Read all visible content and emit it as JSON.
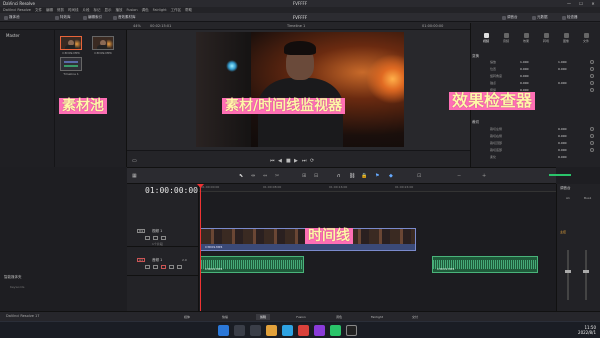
{
  "window": {
    "app_name": "DaVinci Resolve",
    "project_title": "FVFFFF",
    "controls": [
      "—",
      "☐",
      "✕"
    ]
  },
  "menu": [
    "DaVinci Resolve",
    "文件",
    "编辑",
    "修剪",
    "时间线",
    "片段",
    "标记",
    "显示",
    "播放",
    "Fusion",
    "调色",
    "Fairlight",
    "工作区",
    "帮助"
  ],
  "toolbar": {
    "media_pool": "媒体池",
    "effects": "特效库",
    "edit_index": "编辑索引",
    "sound_library": "音效素材库",
    "mixer": "调音台",
    "metadata": "元数据",
    "inspector": "检查器"
  },
  "viewer": {
    "zoom": "44%",
    "source_tc": "00:02:15:01",
    "timeline_name": "Timeline 1",
    "record_tc": "01:00:00:00"
  },
  "media_pool": {
    "bin": "Master",
    "clips": [
      "C3D09.MP4",
      "C3D09.MP4",
      "Timeline 1"
    ],
    "smart_bins": "智能媒体夹",
    "keywords": "Keywords"
  },
  "inspector": {
    "header": "时间线 - 多轨片段",
    "tabs": [
      "视频",
      "音频",
      "效果",
      "转场",
      "图像",
      "文件"
    ],
    "section_transform": "变换",
    "properties": [
      {
        "label": "缩放",
        "x": "1.000",
        "y": "1.000"
      },
      {
        "label": "位置",
        "x": "0.000",
        "y": "0.000"
      },
      {
        "label": "旋转角度",
        "x": "0.000",
        "y": ""
      },
      {
        "label": "锚点",
        "x": "0.000",
        "y": "0.000"
      },
      {
        "label": "俯仰",
        "x": "0.000",
        "y": ""
      },
      {
        "label": "偏航",
        "x": "0.000",
        "y": ""
      }
    ],
    "section_crop": "裁切",
    "crop": [
      {
        "label": "裁切左侧",
        "value": "0.000"
      },
      {
        "label": "裁切右侧",
        "value": "0.000"
      },
      {
        "label": "裁切顶部",
        "value": "0.000"
      },
      {
        "label": "裁切底部",
        "value": "0.000"
      },
      {
        "label": "柔化",
        "value": "0.000"
      }
    ]
  },
  "timeline": {
    "timecode": "01:00:00:00",
    "ruler": [
      "01:00:00:00",
      "01:00:08:00",
      "01:00:16:00",
      "01:00:24:00"
    ],
    "tracks": [
      {
        "tag": "V1",
        "name": "视频 1",
        "clip_count": "1个片段"
      },
      {
        "tag": "A1",
        "name": "音频 1",
        "level": "2.0"
      }
    ],
    "video_clip": "C3D09.MP4",
    "audio_clip_1": "C3D09.MP4",
    "audio_clip_2": "C3D09.MP4"
  },
  "mixer": {
    "title": "调音台",
    "channels": [
      "A1",
      "Bus1"
    ],
    "meters": "主控"
  },
  "pages": [
    "媒体",
    "快编",
    "剪辑",
    "Fusion",
    "调色",
    "Fairlight",
    "交付"
  ],
  "brand": "DaVinci Resolve 17",
  "taskbar": {
    "time": "11:50",
    "date": "2022/8/1"
  },
  "annotations": {
    "media_pool": "素材池",
    "viewer": "素材/时间线监视器",
    "inspector": "效果检查器",
    "timeline": "时间线"
  }
}
